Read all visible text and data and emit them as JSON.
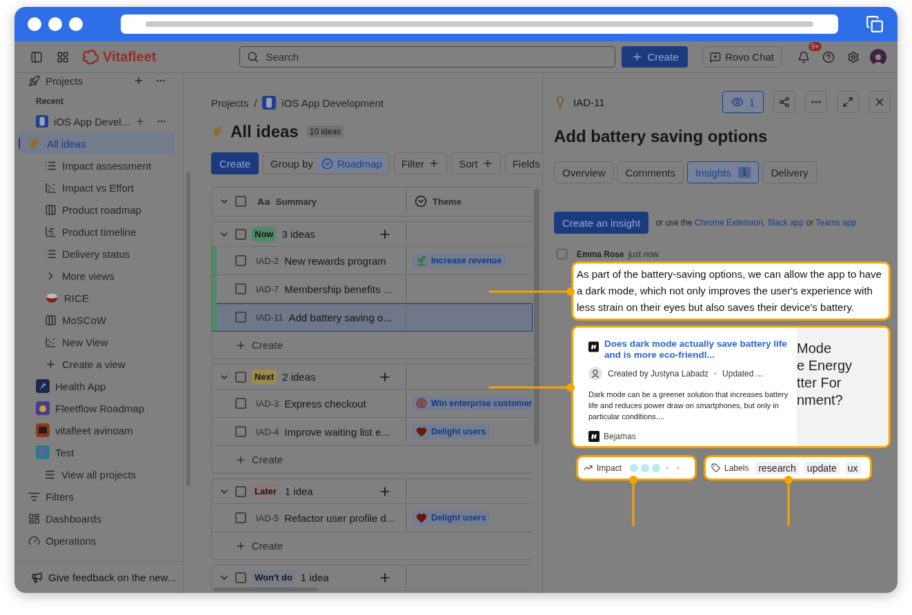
{
  "top_nav": {
    "logo": "Vitafleet",
    "search": {
      "placeholder": "Search"
    },
    "create_button": "Create",
    "rovo_chat": "Rovo Chat",
    "notifications_badge": "9+"
  },
  "sidebar": {
    "projects_header": "Projects",
    "recent_label": "Recent",
    "projects": [
      {
        "label": "iOS App Devel...",
        "expanded": true,
        "children": [
          {
            "label": "All ideas",
            "kind": "view",
            "selected": true
          },
          {
            "label": "Impact assessment",
            "kind": "view",
            "selected": false
          },
          {
            "label": "Impact vs Effort",
            "kind": "view",
            "selected": false
          },
          {
            "label": "Product roadmap",
            "kind": "view",
            "selected": false
          },
          {
            "label": "Product timeline",
            "kind": "view",
            "selected": false
          },
          {
            "label": "Delivery status",
            "kind": "view",
            "selected": false
          },
          {
            "label": "More views",
            "kind": "expander",
            "selected": false
          },
          {
            "label": "RICE",
            "kind": "view",
            "selected": false
          },
          {
            "label": "MoSCoW",
            "kind": "view",
            "selected": false
          },
          {
            "label": "New View",
            "kind": "view",
            "selected": false
          },
          {
            "label": "Create a view",
            "kind": "create",
            "selected": false
          }
        ]
      },
      {
        "label": "Health App"
      },
      {
        "label": "Fleetflow Roadmap"
      },
      {
        "label": "vitafleet avinoam"
      },
      {
        "label": "Test"
      },
      {
        "label": "View all projects"
      }
    ],
    "nav": [
      "Filters",
      "Dashboards",
      "Operations"
    ],
    "feedback": "Give feedback on the new..."
  },
  "main": {
    "breadcrumb": {
      "items": [
        "Projects",
        "iOS App Development"
      ],
      "separator": "/"
    },
    "title": "All ideas",
    "count": "10 ideas",
    "toolbar": {
      "create": "Create",
      "group_by": {
        "label": "Group by",
        "value": "Roadmap"
      },
      "buttons": [
        "Filter",
        "Sort",
        "Fields"
      ]
    },
    "table": {
      "select_all_checked": false,
      "columns": [
        {
          "label": "Summary",
          "kind": "text",
          "type_label": "Aa"
        },
        {
          "label": "Theme",
          "kind": "select"
        }
      ],
      "groups": [
        {
          "tag": "Now",
          "color": "#4e8a67",
          "count": "3 ideas",
          "checked": false,
          "strip": true,
          "create": "Create",
          "rows": [
            {
              "id": "IAD-2",
              "summary": "New rewards program",
              "theme": {
                "label": "Increase revenue",
                "kind": "growth"
              },
              "selected": false
            },
            {
              "id": "IAD-7",
              "summary": "Membership benefits ...",
              "selected": false
            },
            {
              "id": "IAD-11",
              "summary": "Add battery saving o...",
              "selected": true
            }
          ]
        },
        {
          "tag": "Next",
          "color": "#9a8a4c",
          "count": "2 ideas",
          "checked": false,
          "strip": false,
          "create": "Create",
          "rows": [
            {
              "id": "IAD-3",
              "summary": "Express checkout",
              "theme": {
                "label": "Win enterprise customer",
                "kind": "goal"
              },
              "selected": false
            },
            {
              "id": "IAD-4",
              "summary": "Improve waiting list e...",
              "theme": {
                "label": "Delight users",
                "kind": "love"
              },
              "selected": false
            }
          ]
        },
        {
          "tag": "Later",
          "color": "#8a7878",
          "count": "1 idea",
          "checked": false,
          "strip": false,
          "create": "Create",
          "rows": [
            {
              "id": "IAD-5",
              "summary": "Refactor user profile d...",
              "theme": {
                "label": "Delight users",
                "kind": "love"
              },
              "selected": false
            }
          ]
        },
        {
          "tag": "Won't do",
          "color": "#767d88",
          "count": "1 idea",
          "checked": false,
          "strip": false
        }
      ]
    }
  },
  "panel": {
    "key": "IAD-11",
    "watchers": "1",
    "title": "Add battery saving options",
    "tabs": [
      {
        "label": "Overview",
        "selected": false
      },
      {
        "label": "Comments",
        "selected": false
      },
      {
        "label": "Insights",
        "count": "1",
        "selected": true
      },
      {
        "label": "Delivery",
        "selected": false
      }
    ],
    "create_insight": "Create an insight",
    "hint": [
      {
        "kind": "text",
        "text": "or use the "
      },
      {
        "kind": "link",
        "text": "Chrome Extension"
      },
      {
        "kind": "text",
        "text": ", "
      },
      {
        "kind": "link",
        "text": "Slack app"
      },
      {
        "kind": "text",
        "text": " or "
      },
      {
        "kind": "link",
        "text": "Teams app"
      }
    ],
    "insight": {
      "author": "Emma Rose",
      "time": "just now",
      "checked": false,
      "text": "As part of the battery-saving options, we can allow the app to have a dark mode, which not only improves the user's experience with less strain on their eyes but also saves their device's battery.",
      "card": {
        "title": "Does dark mode actually save battery life and is more eco-friendl...",
        "byline": "Created by Justyna Labadz",
        "updated": "Updated ...",
        "body": "Dark mode can be a greener solution that increases battery life and reduces power draw on smartphones, but only in particular conditions....",
        "source": "Bejamas",
        "preview_lines": [
          "Mode",
          "e Energy",
          "tter For",
          "nment?"
        ]
      },
      "impact": {
        "label": "Impact",
        "stars": 3
      },
      "labels": {
        "label": "Labels",
        "items": [
          "research",
          "update",
          "ux"
        ]
      }
    }
  }
}
